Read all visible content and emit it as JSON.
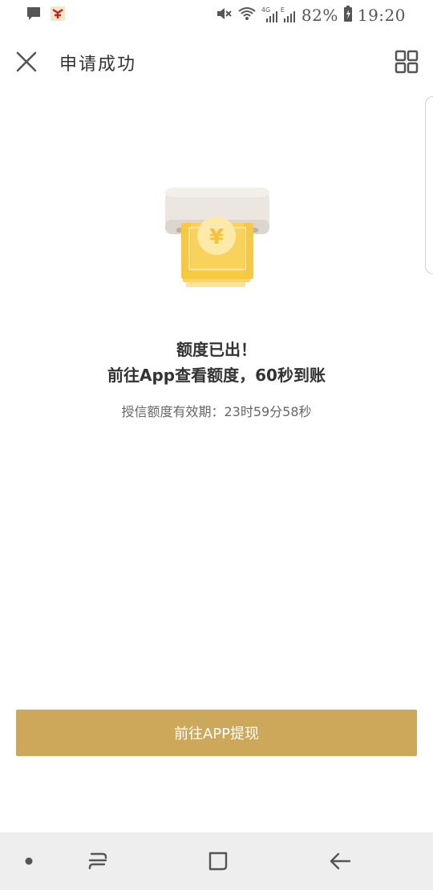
{
  "status_bar": {
    "battery_percent": "82%",
    "time": "19:20",
    "network_label": "4G",
    "network_label_2": "E",
    "icons": [
      "message-icon",
      "app-notification-icon",
      "mute-icon",
      "wifi-icon",
      "signal-icon",
      "battery-icon"
    ]
  },
  "header": {
    "title": "申请成功",
    "close_icon": "close-icon",
    "menu_icon": "grid-menu-icon"
  },
  "illustration": {
    "icon": "cash-dispenser-illustration",
    "symbol": "¥",
    "colors": {
      "machine": "#e8e3dc",
      "bill": "#f7c842",
      "coin": "#fde9a8"
    }
  },
  "result": {
    "line1": "额度已出！",
    "line2": "前往App查看额度，60秒到账",
    "validity_label": "授信额度有效期：",
    "validity_time": "23时59分58秒"
  },
  "action": {
    "button_label": "前往APP提现",
    "button_color": "#cea85a"
  },
  "nav_bar": {
    "items": [
      "dot-icon",
      "recent-apps-icon",
      "home-icon",
      "back-icon"
    ]
  }
}
